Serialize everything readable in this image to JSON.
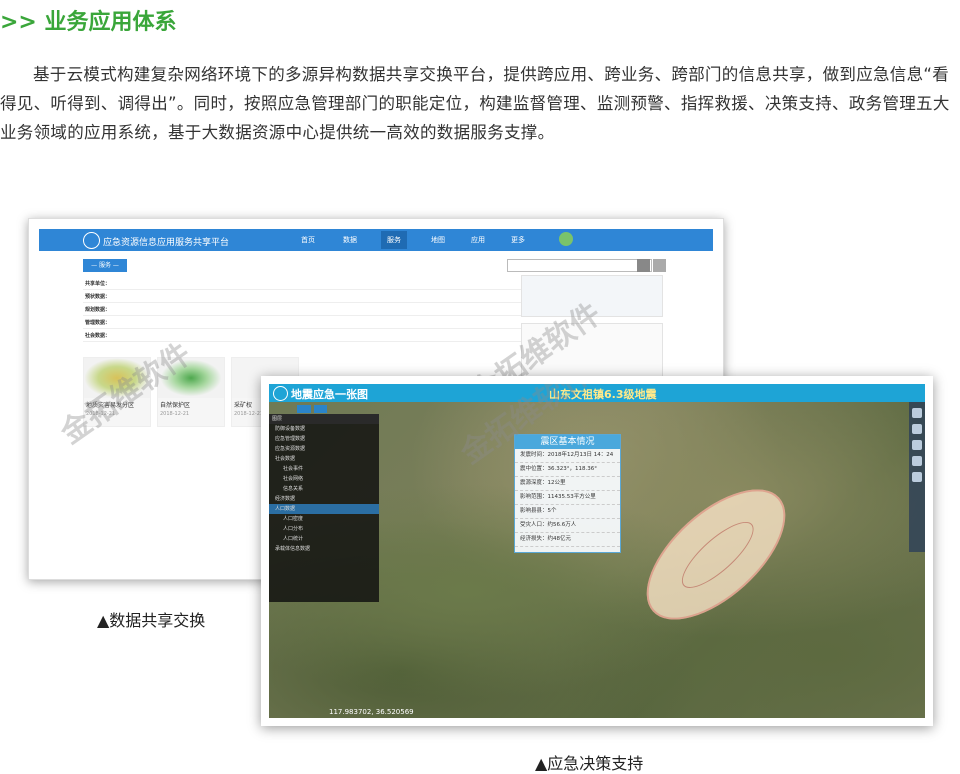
{
  "heading": ">> 业务应用体系",
  "paragraph": "基于云模式构建复杂网络环境下的多源异构数据共享交换平台，提供跨应用、跨业务、跨部门的信息共享，做到应急信息“看得见、听得到、调得出”。同时，按照应急管理部门的职能定位，构建监督管理、监测预警、指挥救援、决策支持、政务管理五大业务领域的应用系统，基于大数据资源中心提供统一高效的数据服务支撑。",
  "screenshot1": {
    "app_title": "应急资源信息应用服务共享平台",
    "nav": [
      "首页",
      "数据",
      "服务",
      "地图",
      "应用",
      "更多"
    ],
    "service_tag": "— 服务 —",
    "filter_rows": [
      "共享单位：",
      "预状数据：",
      "规划数据：",
      "管理数据：",
      "社会数据："
    ],
    "cards": [
      {
        "title": "地质灾害易发分区",
        "date": "2018-12-21"
      },
      {
        "title": "自然保护区",
        "date": "2018-12-21"
      },
      {
        "title": "采矿权",
        "date": "2018-12-21"
      }
    ],
    "caption": "▲数据共享交换"
  },
  "screenshot2": {
    "app_title": "地震应急一张图",
    "event_title": "山东文祖镇6.3级地震",
    "info_title": "震区基本情况",
    "info_rows": [
      "发震时间：2018年12月13日 14：24",
      "震中位置：36.323°，118.36°",
      "震源深度：12公里",
      "影响范围：11435.53平方公里",
      "影响县县：5个",
      "受灾人口：约56.6万人",
      "经济损失：约48亿元"
    ],
    "layers": [
      "防御设备数据",
      "应急管理数据",
      "应急资源数据",
      "社会数据",
      "社会事件",
      "社会网络",
      "信息关系",
      "经济数据",
      "人口数据",
      "人口密度",
      "人口分布",
      "人口统计",
      "承载体信息数据"
    ],
    "coordinates": "117.983702, 36.520569",
    "caption": "▲应急决策支持"
  },
  "watermark": "金拓维软件"
}
